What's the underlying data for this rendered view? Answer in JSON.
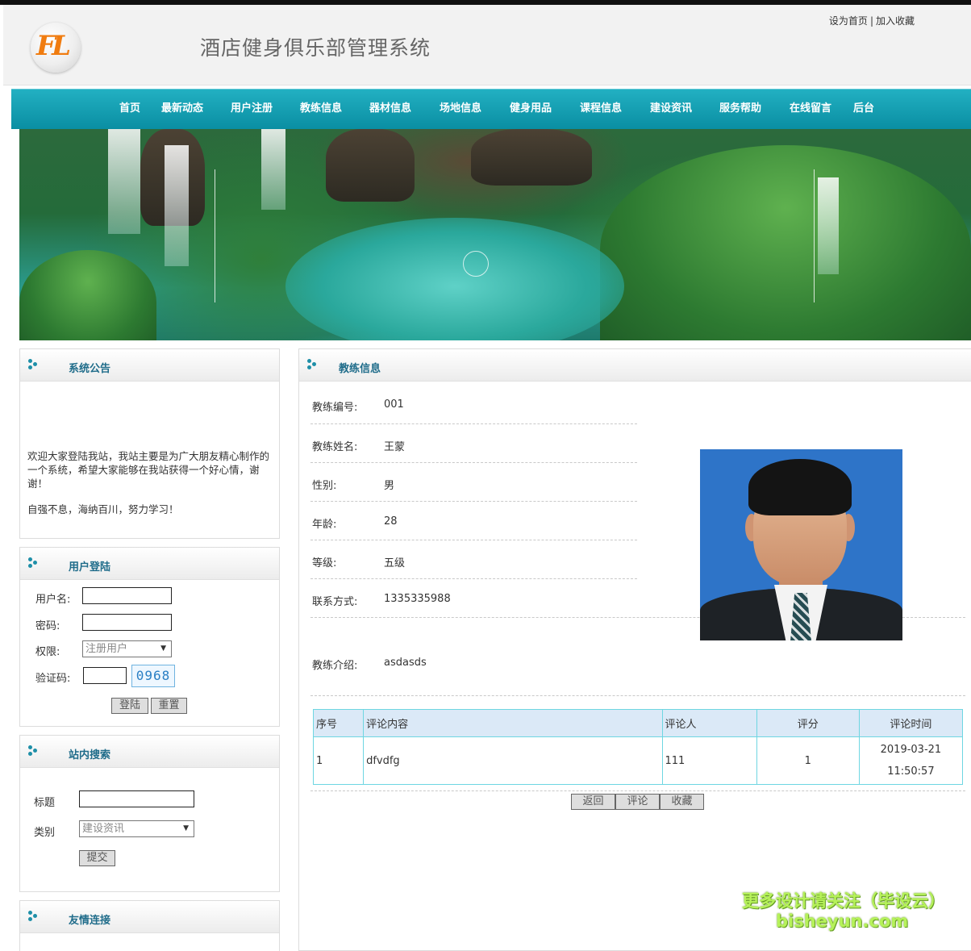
{
  "header": {
    "logo_text": "FL",
    "site_title": "酒店健身俱乐部管理系统",
    "links": {
      "set_home": "设为首页",
      "separator": "|",
      "add_favorite": "加入收藏"
    }
  },
  "nav": {
    "items": [
      "首页",
      "最新动态",
      "用户注册",
      "教练信息",
      "器材信息",
      "场地信息",
      "健身用品",
      "课程信息",
      "建设资讯",
      "服务帮助",
      "在线留言",
      "后台"
    ]
  },
  "sidebar": {
    "notice": {
      "title": "系统公告",
      "text": "欢迎大家登陆我站，我站主要是为广大朋友精心制作的一个系统，希望大家能够在我站获得一个好心情，谢谢！",
      "motto": "自强不息，海纳百川，努力学习！"
    },
    "login": {
      "title": "用户登陆",
      "username_label": "用户名:",
      "username_value": "",
      "password_label": "密码:",
      "password_value": "",
      "role_label": "权限:",
      "role_selected": "注册用户",
      "captcha_label": "验证码:",
      "captcha_value": "",
      "captcha_code": "0968",
      "login_button": "登陆",
      "reset_button": "重置"
    },
    "search": {
      "title": "站内搜索",
      "title_label": "标题",
      "title_value": "",
      "category_label": "类别",
      "category_selected": "建设资讯",
      "submit_button": "提交"
    },
    "links": {
      "title": "友情连接"
    }
  },
  "main": {
    "title": "教练信息",
    "fields": {
      "id_label": "教练编号:",
      "id_value": "001",
      "name_label": "教练姓名:",
      "name_value": "王蒙",
      "gender_label": "性别:",
      "gender_value": "男",
      "age_label": "年龄:",
      "age_value": "28",
      "level_label": "等级:",
      "level_value": "五级",
      "contact_label": "联系方式:",
      "contact_value": "1335335988",
      "intro_label": "教练介绍:",
      "intro_value": "asdasds"
    },
    "comments": {
      "headers": [
        "序号",
        "评论内容",
        "评论人",
        "评分",
        "评论时间"
      ],
      "rows": [
        {
          "no": "1",
          "content": "dfvdfg",
          "author": "111",
          "score": "1",
          "date": "2019-03-21",
          "time": "11:50:57"
        }
      ]
    },
    "buttons": {
      "back": "返回",
      "comment": "评论",
      "favorite": "收藏"
    }
  },
  "watermark": {
    "line1": "更多设计请关注（毕设云）",
    "line2": "bisheyun.com"
  }
}
